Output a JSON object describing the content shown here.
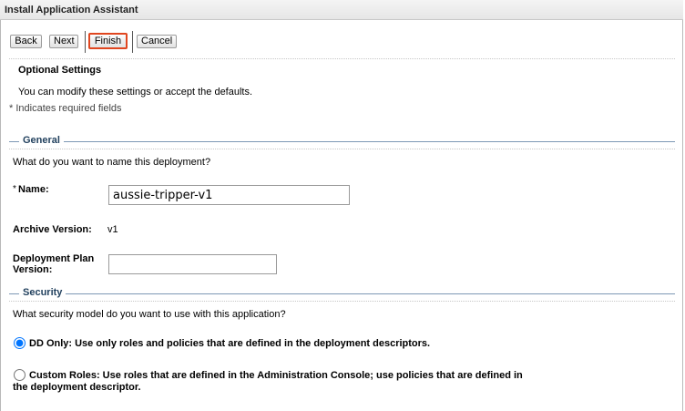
{
  "window": {
    "title": "Install Application Assistant"
  },
  "toolbar": {
    "back_label": "Back",
    "next_label": "Next",
    "finish_label": "Finish",
    "cancel_label": "Cancel"
  },
  "page": {
    "heading": "Optional Settings",
    "description": "You can modify these settings or accept the defaults.",
    "required_note": "* Indicates required fields"
  },
  "general": {
    "legend": "General",
    "question": "What do you want to name this deployment?",
    "name_required_marker": "*",
    "name_label": "Name:",
    "name_value": "aussie-tripper-v1",
    "archive_version_label": "Archive Version:",
    "archive_version_value": "v1",
    "plan_version_label_line1": "Deployment Plan",
    "plan_version_label_line2": "Version:",
    "plan_version_value": ""
  },
  "security": {
    "legend": "Security",
    "question": "What security model do you want to use with this application?",
    "options": [
      {
        "label": "DD Only: Use only roles and policies that are defined in the deployment descriptors.",
        "selected": true
      },
      {
        "label_line1": "Custom Roles: Use roles that are defined in the Administration Console; use policies that are defined in",
        "label_line2": "the deployment descriptor.",
        "selected": false
      }
    ]
  },
  "colors": {
    "finish_highlight": "#e0461f",
    "legend_text": "#23425f",
    "legend_rule": "#7d98b5"
  }
}
